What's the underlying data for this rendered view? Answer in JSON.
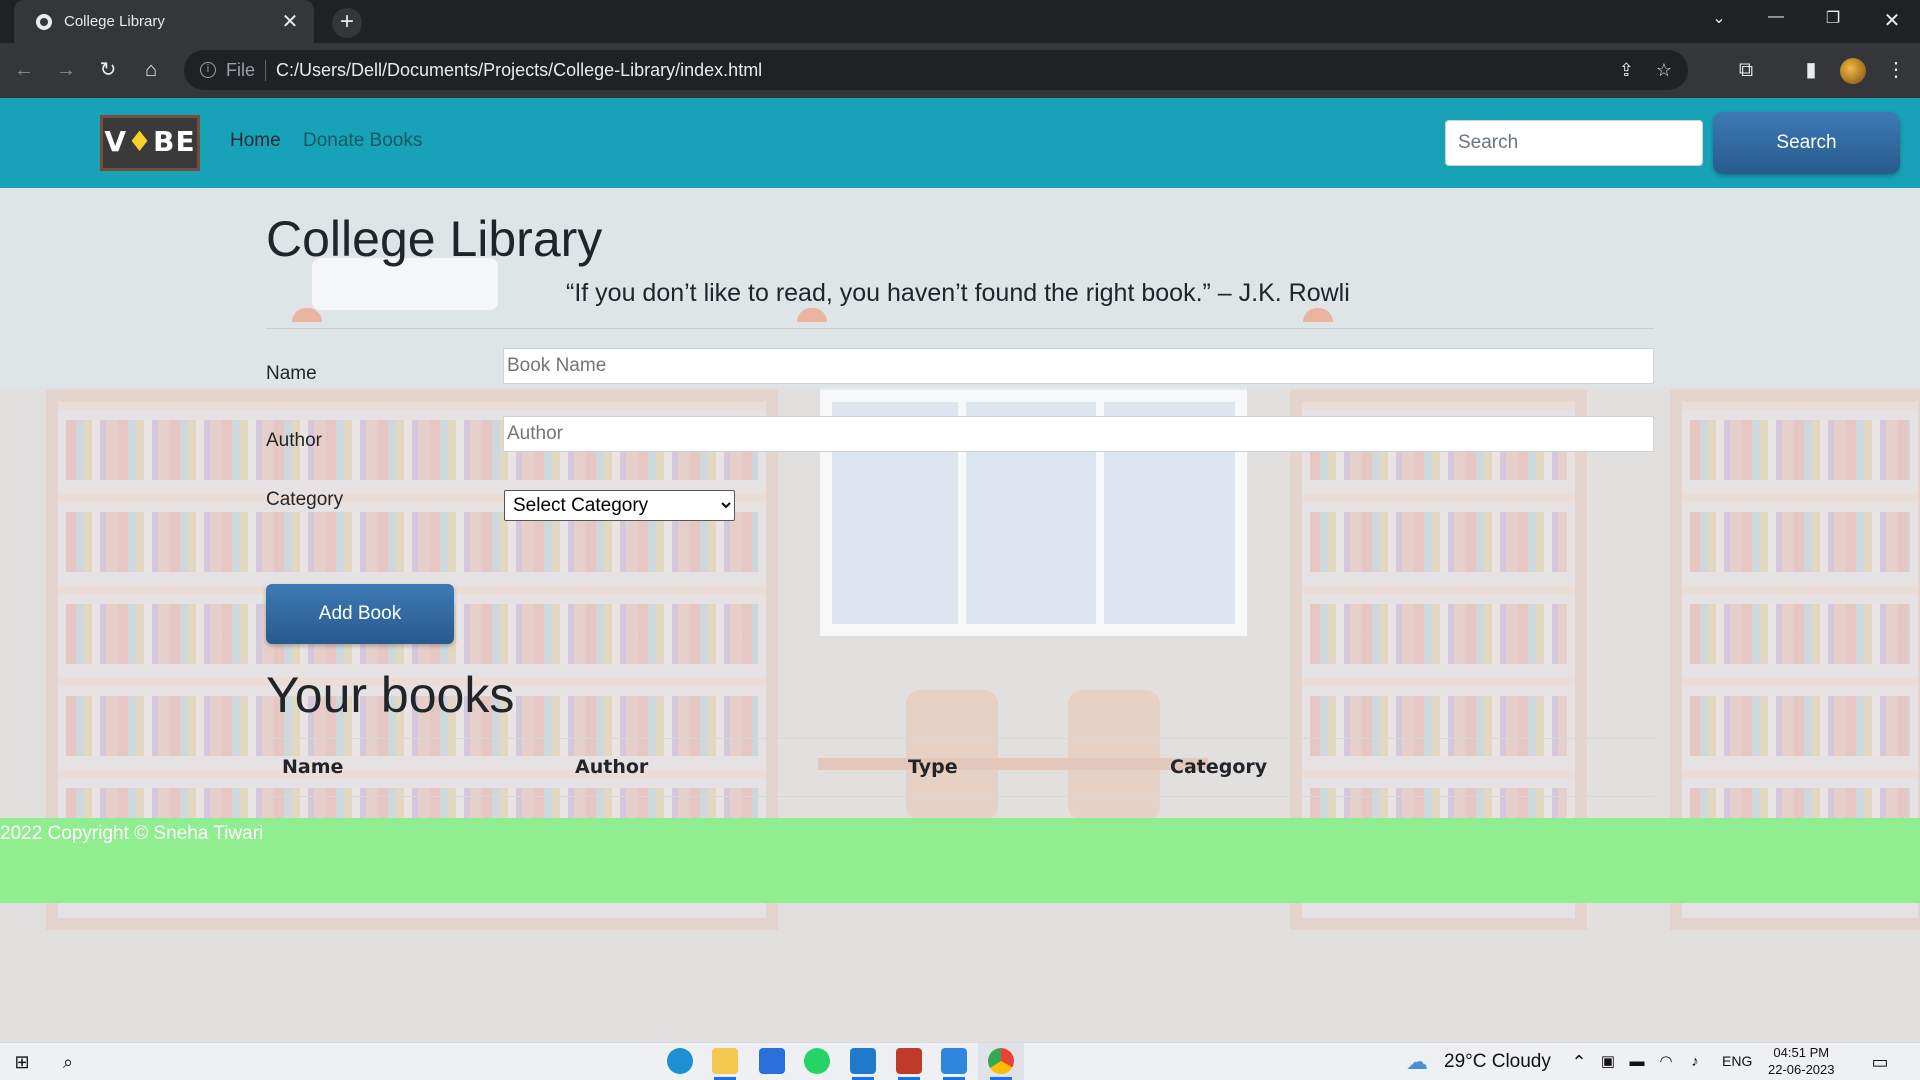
{
  "browser": {
    "tab_title": "College Library",
    "tab_close": "✕",
    "new_tab": "+",
    "url_scheme": "File",
    "url": "C:/Users/Dell/Documents/Projects/College-Library/index.html"
  },
  "navbar": {
    "logo_text_pre": "V",
    "logo_text_mid": "♦",
    "logo_text_post": "BE",
    "home": "Home",
    "donate": "Donate Books",
    "search_placeholder": "Search",
    "search_button": "Search"
  },
  "main": {
    "title": "College Library",
    "quote": "“If you don’t like to read, you haven’t found the right book.” – J.K. Rowli",
    "form": {
      "name_label": "Name",
      "name_placeholder": "Book Name",
      "author_label": "Author",
      "author_placeholder": "Author",
      "category_label": "Category",
      "category_selected": "Select Category",
      "add_button": "Add Book"
    },
    "books_title": "Your books",
    "table_headers": [
      "Name",
      "Author",
      "Type",
      "Category"
    ]
  },
  "footer": {
    "text": "2022 Copyright © Sneha Tiwari"
  },
  "taskbar": {
    "weather": "29°C  Cloudy",
    "language": "ENG",
    "time": "04:51 PM",
    "date": "22-06-2023"
  },
  "colors": {
    "navbar": "#17a2b8",
    "button": "#285a8c",
    "footer": "#90ee90"
  }
}
